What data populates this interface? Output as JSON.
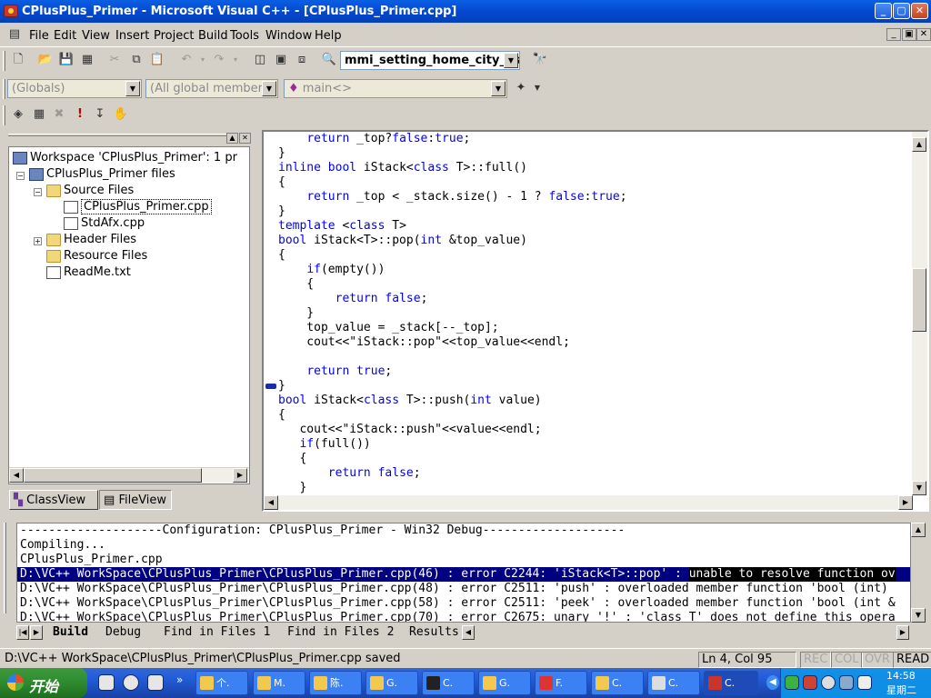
{
  "window": {
    "title": "CPlusPlus_Primer - Microsoft Visual C++ - [CPlusPlus_Primer.cpp]",
    "min": "_",
    "max": "▢",
    "close": "✕"
  },
  "menu": [
    "File",
    "Edit",
    "View",
    "Insert",
    "Project",
    "Build",
    "Tools",
    "Window",
    "Help"
  ],
  "toolbar": {
    "find_combo": "mmi_setting_home_city_as",
    "globals_combo": "(Globals)",
    "members_combo": "(All global members",
    "function_combo": "main<>"
  },
  "workspace": {
    "root": "Workspace 'CPlusPlus_Primer': 1 pr",
    "project": "CPlusPlus_Primer files",
    "source_folder": "Source Files",
    "file1": "CPlusPlus_Primer.cpp",
    "file2": "StdAfx.cpp",
    "header_folder": "Header Files",
    "resource_folder": "Resource Files",
    "readme": "ReadMe.txt",
    "tab_classview": "ClassView",
    "tab_fileview": "FileView"
  },
  "code_lines": [
    [
      [
        "    ",
        ""
      ],
      [
        "return",
        "kw"
      ],
      [
        " _top?",
        ""
      ],
      [
        "false",
        "kw"
      ],
      [
        ":",
        ""
      ],
      [
        "true",
        "kw"
      ],
      [
        ";",
        ""
      ]
    ],
    [
      [
        "}",
        ""
      ]
    ],
    [
      [
        "inline",
        "kw"
      ],
      [
        " ",
        ""
      ],
      [
        "bool",
        "kw"
      ],
      [
        " iStack<",
        ""
      ],
      [
        "class",
        "kw"
      ],
      [
        " T>::full()",
        ""
      ]
    ],
    [
      [
        "{",
        ""
      ]
    ],
    [
      [
        "    ",
        ""
      ],
      [
        "return",
        "kw"
      ],
      [
        " _top < _stack.size() - 1 ? ",
        ""
      ],
      [
        "false",
        "kw"
      ],
      [
        ":",
        ""
      ],
      [
        "true",
        "kw"
      ],
      [
        ";",
        ""
      ]
    ],
    [
      [
        "}",
        ""
      ]
    ],
    [
      [
        "template",
        "kw"
      ],
      [
        " <",
        ""
      ],
      [
        "class",
        "kw"
      ],
      [
        " T>",
        ""
      ]
    ],
    [
      [
        "bool",
        "kw"
      ],
      [
        " iStack<T>::pop(",
        ""
      ],
      [
        "int",
        "kw"
      ],
      [
        " &top_value)",
        ""
      ]
    ],
    [
      [
        "{",
        ""
      ]
    ],
    [
      [
        "    ",
        ""
      ],
      [
        "if",
        "kw"
      ],
      [
        "(empty())",
        ""
      ]
    ],
    [
      [
        "    {",
        ""
      ]
    ],
    [
      [
        "        ",
        ""
      ],
      [
        "return",
        "kw"
      ],
      [
        " ",
        ""
      ],
      [
        "false",
        "kw"
      ],
      [
        ";",
        ""
      ]
    ],
    [
      [
        "    }",
        ""
      ]
    ],
    [
      [
        "    top_value = _stack[--_top];",
        ""
      ]
    ],
    [
      [
        "    cout<<\"iStack::pop\"<<top_value<<endl;",
        ""
      ]
    ],
    [
      [
        "",
        ""
      ]
    ],
    [
      [
        "    ",
        ""
      ],
      [
        "return",
        "kw"
      ],
      [
        " ",
        ""
      ],
      [
        "true",
        "kw"
      ],
      [
        ";",
        ""
      ]
    ],
    [
      [
        "}",
        ""
      ]
    ],
    [
      [
        "bool",
        "kw"
      ],
      [
        " iStack<",
        ""
      ],
      [
        "class",
        "kw"
      ],
      [
        " T>::push(",
        ""
      ],
      [
        "int",
        "kw"
      ],
      [
        " value)",
        ""
      ]
    ],
    [
      [
        "{",
        ""
      ]
    ],
    [
      [
        "   cout<<\"iStack::push\"<<value<<endl;",
        ""
      ]
    ],
    [
      [
        "   ",
        ""
      ],
      [
        "if",
        "kw"
      ],
      [
        "(full())",
        ""
      ]
    ],
    [
      [
        "   {",
        ""
      ]
    ],
    [
      [
        "       ",
        ""
      ],
      [
        "return",
        "kw"
      ],
      [
        " ",
        ""
      ],
      [
        "false",
        "kw"
      ],
      [
        ";",
        ""
      ]
    ],
    [
      [
        "   }",
        ""
      ]
    ]
  ],
  "output": {
    "lines": [
      "--------------------Configuration: CPlusPlus_Primer - Win32 Debug--------------------",
      "Compiling...",
      "CPlusPlus_Primer.cpp",
      "D:\\VC++ WorkSpace\\CPlusPlus_Primer\\CPlusPlus_Primer.cpp(46) : error C2244: 'iStack<T>::pop' : ",
      "D:\\VC++ WorkSpace\\CPlusPlus_Primer\\CPlusPlus_Primer.cpp(48) : error C2511: 'push' : overloaded member function 'bool (int)",
      "D:\\VC++ WorkSpace\\CPlusPlus_Primer\\CPlusPlus_Primer.cpp(58) : error C2511: 'peek' : overloaded member function 'bool (int &",
      "D:\\VC++ WorkSpace\\CPlusPlus_Primer\\CPlusPlus_Primer.cpp(70) : error C2675: unary '!' : 'class T' does not define this opera"
    ],
    "highlight_tail": "unable to resolve function ov",
    "tabs": [
      "Build",
      "Debug",
      "Find in Files 1",
      "Find in Files 2",
      "Results"
    ]
  },
  "status": {
    "message": "D:\\VC++ WorkSpace\\CPlusPlus_Primer\\CPlusPlus_Primer.cpp saved",
    "position": "Ln 4, Col 95",
    "rec": "REC",
    "col": "COL",
    "ovr": "OVR",
    "read": "READ"
  },
  "taskbar": {
    "start": "开始",
    "chevron": "»",
    "tasks": [
      "个.",
      "M.",
      "陈.",
      "G.",
      "C.",
      "G.",
      "F.",
      "C.",
      "C.",
      "C."
    ],
    "clock_time": "14:58",
    "clock_day": "星期二"
  }
}
